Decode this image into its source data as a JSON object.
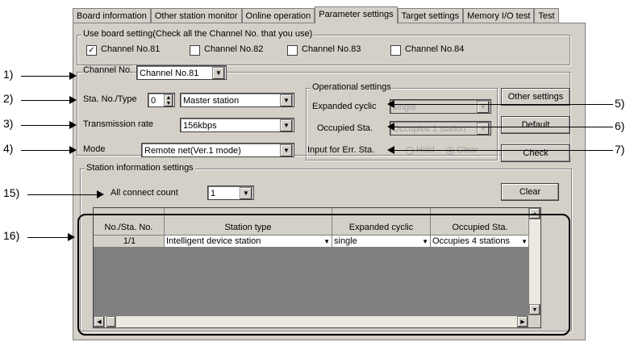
{
  "tabs": [
    "Board information",
    "Other station monitor",
    "Online operation",
    "Parameter settings",
    "Target settings",
    "Memory I/O test",
    "Test"
  ],
  "active_tab": "Parameter settings",
  "use_board": {
    "title": "Use board setting(Check all the Channel No. that you use)",
    "channels": [
      {
        "label": "Channel No.81",
        "checked": true,
        "mark": "✓"
      },
      {
        "label": "Channel No.82",
        "checked": false,
        "mark": ""
      },
      {
        "label": "Channel No.83",
        "checked": false,
        "mark": ""
      },
      {
        "label": "Channel No.84",
        "checked": false,
        "mark": ""
      }
    ]
  },
  "channel": {
    "label": "Channel No.",
    "value": "Channel No.81"
  },
  "station": {
    "label": "Sta. No./Type",
    "number": "0",
    "type": "Master station",
    "rate_label": "Transmission rate",
    "rate": "156kbps",
    "mode_label": "Mode",
    "mode": "Remote net(Ver.1 mode)"
  },
  "operational": {
    "title": "Operational settings",
    "expanded_label": "Expanded cyclic",
    "expanded_value": "single",
    "occupied_label": "Occupied Sta.",
    "occupied_value": "Occupies 1 station",
    "input_label": "Input for Err. Sta.",
    "hold": "Hold",
    "clear": "Clear"
  },
  "buttons": {
    "other": "Other settings",
    "default": "Default",
    "check": "Check",
    "clear": "Clear"
  },
  "station_info": {
    "title": "Station information settings",
    "connect_label": "All connect count",
    "connect_value": "1",
    "columns": [
      "No./Sta. No.",
      "Station type",
      "Expanded cyclic",
      "Occupied Sta."
    ],
    "rows": [
      {
        "no": "1/1",
        "type": "Intelligent device station",
        "expanded": "single",
        "occupied": "Occupies 4 stations"
      }
    ]
  },
  "callouts": {
    "c1": "1)",
    "c2": "2)",
    "c3": "3)",
    "c4": "4)",
    "c5": "5)",
    "c6": "6)",
    "c7": "7)",
    "c15": "15)",
    "c16": "16)"
  },
  "icons": {
    "dropdown": "dropdown-arrow-icon",
    "spin": "spin-icon",
    "check": "checkmark-icon"
  }
}
